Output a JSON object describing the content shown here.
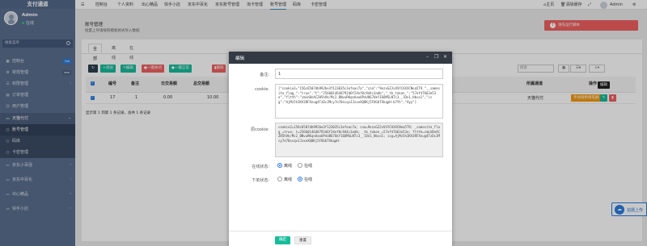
{
  "app": {
    "name": "支付通道",
    "user": "Admin",
    "status": "在线"
  },
  "sidebar": {
    "search_placeholder": "搜索菜单",
    "items": [
      {
        "label": "控制台",
        "badge": "hot",
        "badge_color": "#2a7de1"
      },
      {
        "label": "常规管理",
        "badge": "new",
        "badge_color": "#5a6f8f"
      },
      {
        "label": "权限管理"
      },
      {
        "label": "订单管理"
      },
      {
        "label": "用户管理"
      },
      {
        "label": "天猫代付"
      },
      {
        "label": "账号管理"
      },
      {
        "label": "码库"
      },
      {
        "label": "卡密管理"
      },
      {
        "label": "京东小百强"
      },
      {
        "label": "京东中百化"
      },
      {
        "label": "出心精品"
      },
      {
        "label": "快手小店"
      }
    ]
  },
  "topnav": {
    "items": [
      "控制台",
      "个人资料",
      "出心精品",
      "快手小店",
      "京东中百化",
      "京东账号管理",
      "淘卡管理",
      "账号管理",
      "码库",
      "卡密管理"
    ],
    "selected_index": 7,
    "right": {
      "home": "主页",
      "clear": "清除缓存",
      "user": "Admin"
    }
  },
  "page": {
    "title": "账号管理",
    "subtitle": "批量上导请按照模板格式导入数据"
  },
  "tabs": [
    "全部",
    "离线",
    "在线"
  ],
  "toolbar": {
    "refresh": "",
    "add": "添加",
    "edit": "编辑",
    "offline": "一键关闭",
    "online": "一键正常",
    "delete": "删除"
  },
  "search_placeholder": "搜索",
  "table": {
    "headers": [
      "编号",
      "备注",
      "日交易额",
      "总交易额",
      "所属通道",
      "操作"
    ],
    "row": {
      "id": "17",
      "note": "1",
      "day": "0.00",
      "total": "10.00",
      "channel": "天猫代付",
      "op_label": "手动限制每笔额"
    }
  },
  "pager": "显示第 1 到第 1 条记录，总共 1 条记录",
  "toast": {
    "text": "请先运行脚本"
  },
  "tooltip": "编辑",
  "upload": {
    "label": "拍摄上传"
  },
  "modal": {
    "title": "编辑",
    "fields": {
      "note_label": "备注:",
      "note_value": "1",
      "cookie_label": "cookie:",
      "cookie_value": "[\"cookie2=\"156c6507db992be3f123035c3efeac7a\",\"cna\":\"9ezxGZJvVSYCAXXCNea5T9_\",_samesite_flag_\":\"true\",\"t\":\"2566014648792d6f24ef8c944c3adb\",\"_tb_token_\":\"57ef47663e53e\",\"fltth\":\"cmLhBnACZH5hVk/Mc2_BNvuRKqnAaoUPnU867UkYI6OMSLNTc3__lDn1_Hbco1\",\"isg\":\"AjMz5hIKV3RFXnug4TzDcJMcy7e70scqvJJzxeXQ8Kj5FOGbTXkqpH-b7Yh\",\"Ayy\"]",
      "orig_cookie_label": "原cookie:",
      "orig_cookie_value": "cookie2=156c6507db992be3f123035c3efeac7a; cna=9ezxGZJvVSYCAXXCNea5T9; _samesite_flag_=true; t=2566014648792d6f24ef8c944c3adb; _tb_token_=57ef47663e53e; fltth=cmLhBnACZH5hVk/Mc2_BNvuRKqnAaoUPnU867UkYI6OMSLNTc3__lDn1_Hbco1; isg=AjMz5hIKV3RFXnug4TzDcJMcy7e70scqvJJzxeXQ8Kj5FOGbTXkqpH-",
      "online_label": "在线状态:",
      "online_opts": [
        "离线",
        "在线"
      ],
      "online_selected": 0,
      "order_label": "下单状态:",
      "order_opts": [
        "离线",
        "在线"
      ],
      "order_selected": 1
    },
    "confirm": "确定",
    "reset": "重置"
  }
}
